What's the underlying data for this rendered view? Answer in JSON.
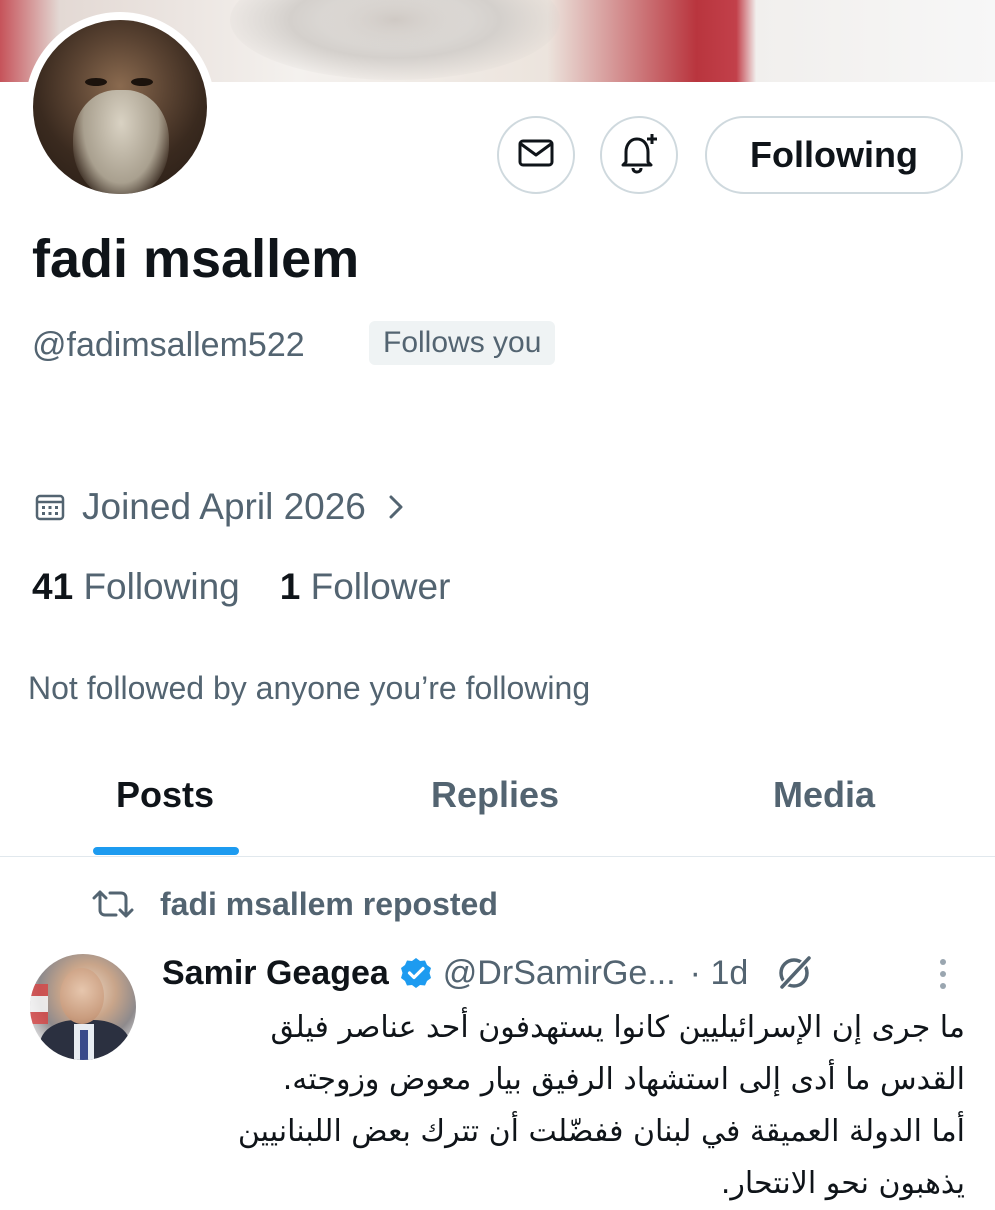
{
  "profile": {
    "name": "fadi msallem",
    "handle": "@fadimsallem522",
    "follows_you_badge": "Follows you",
    "joined": "Joined April 2026",
    "following_count": "41",
    "following_label": "Following",
    "followers_count": "1",
    "followers_label": "Follower",
    "not_followed_note": "Not followed by anyone you’re following"
  },
  "actions": {
    "message_icon": "envelope-icon",
    "notify_icon": "bell-plus-icon",
    "following_button": "Following"
  },
  "tabs": [
    {
      "label": "Posts",
      "active": true
    },
    {
      "label": "Replies",
      "active": false
    },
    {
      "label": "Media",
      "active": false
    }
  ],
  "post": {
    "repost_label": "fadi msallem reposted",
    "author_name": "Samir Geagea",
    "author_handle": "@DrSamirGe...",
    "time": "· 1d",
    "verified_color": "#1d9bf0",
    "text_lines": [
      "ما جرى إن الإسرائيليين كانوا يستهدفون أحد عناصر فيلق",
      "القدس ما أدى إلى استشهاد الرفيق بيار معوض وزوجته.",
      "أما الدولة العميقة في لبنان ففضّلت أن تترك بعض اللبنانيين",
      "يذهبون نحو الانتحار."
    ]
  },
  "colors": {
    "accent": "#1d9bf0",
    "text_primary": "#0f1419",
    "text_secondary": "#536471",
    "border": "#cfd9de"
  }
}
